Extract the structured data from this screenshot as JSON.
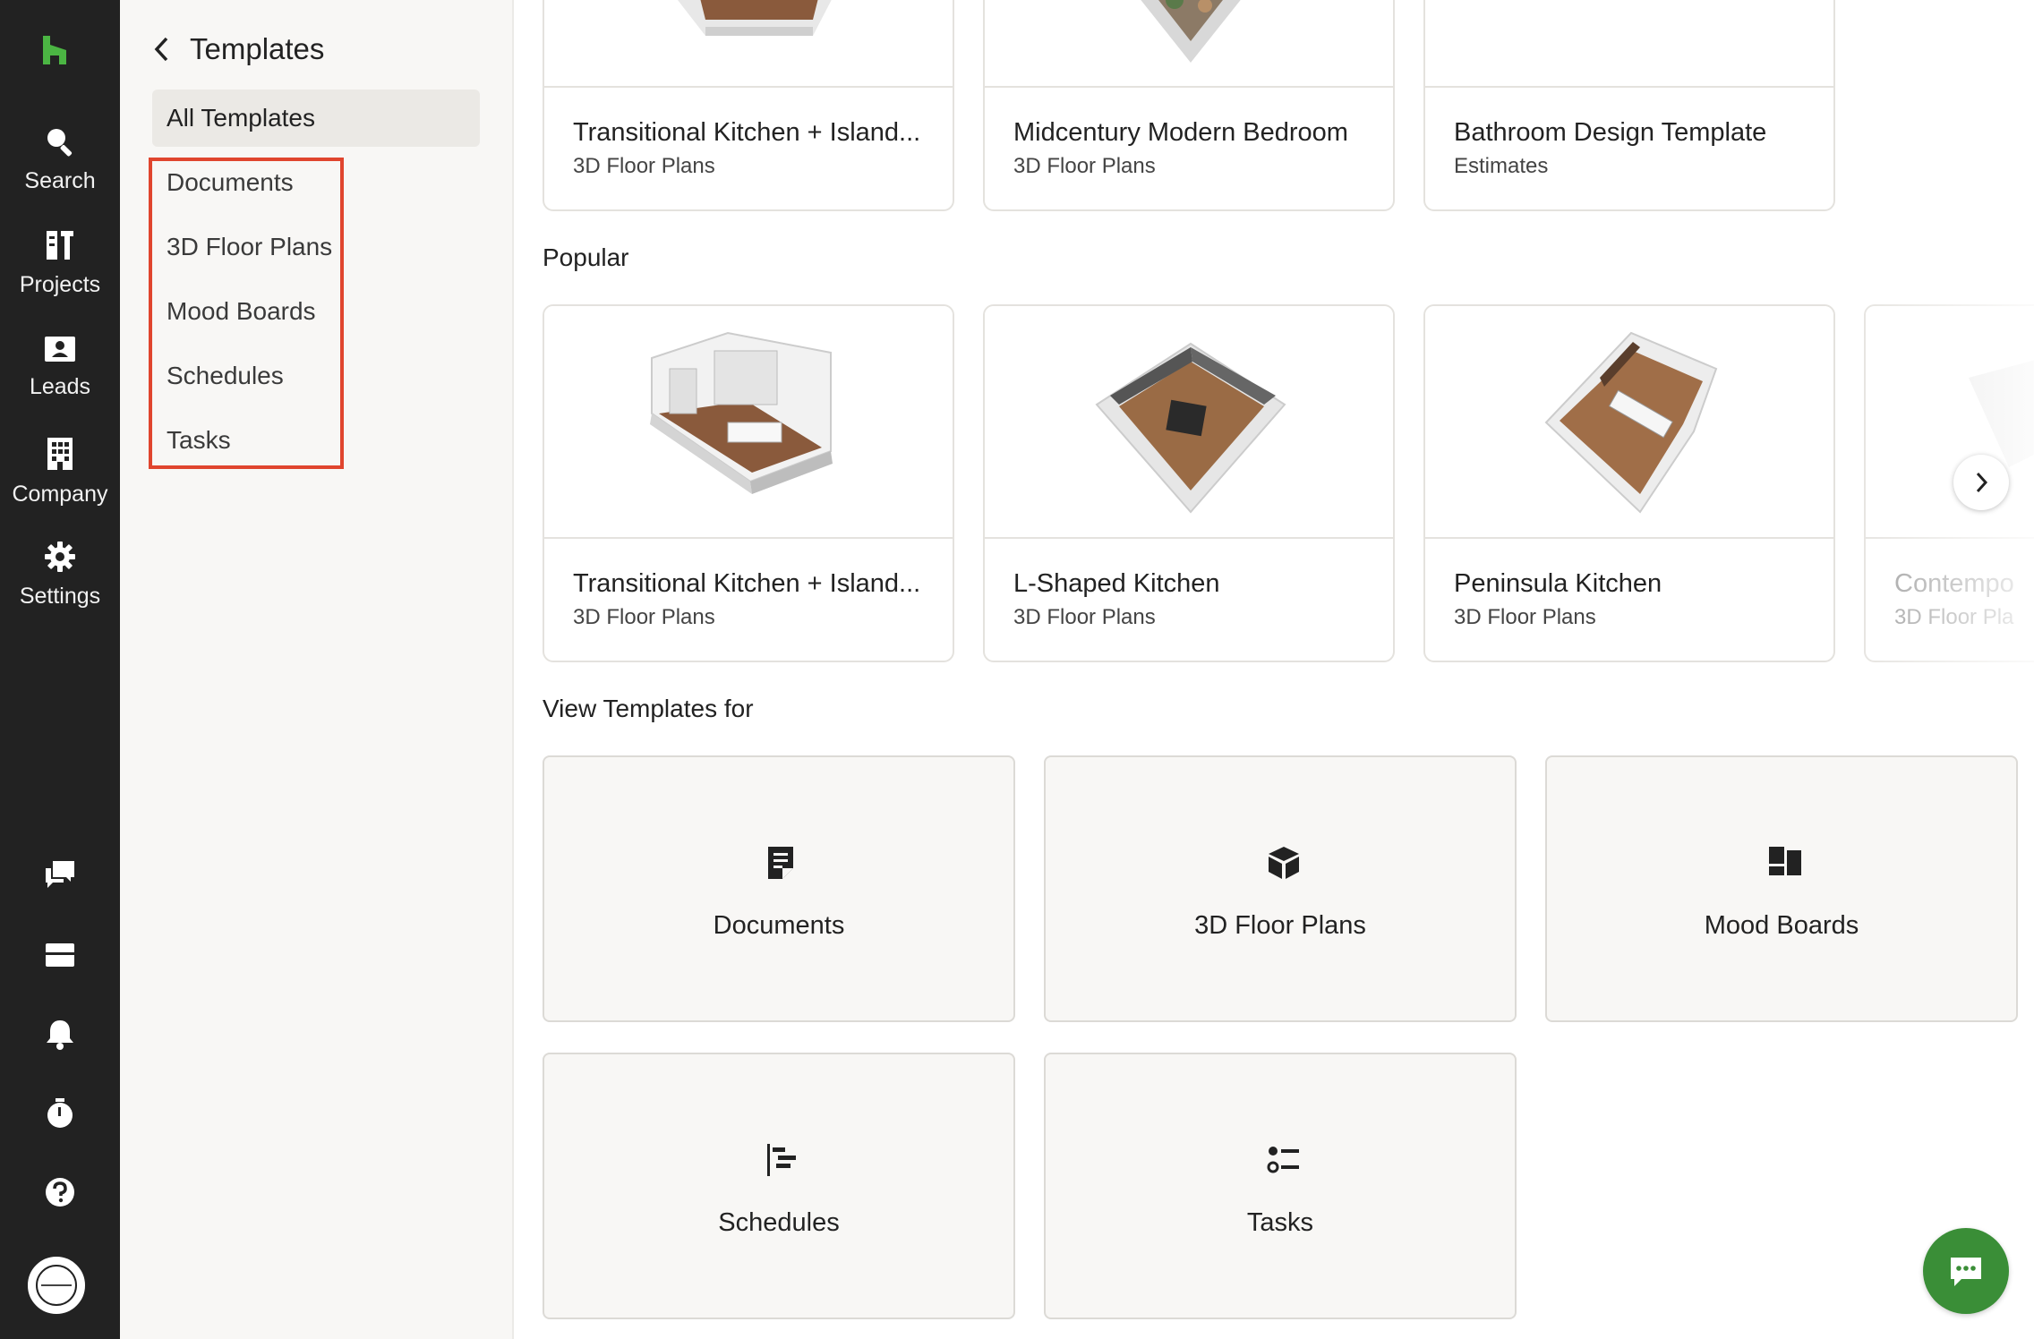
{
  "rail": {
    "items": [
      {
        "label": "Search",
        "icon": "search-icon"
      },
      {
        "label": "Projects",
        "icon": "projects-icon"
      },
      {
        "label": "Leads",
        "icon": "leads-icon"
      },
      {
        "label": "Company",
        "icon": "company-icon"
      },
      {
        "label": "Settings",
        "icon": "gear-icon"
      }
    ],
    "bottom_icons": [
      "messages-icon",
      "inbox-icon",
      "bell-icon",
      "timer-icon",
      "help-icon"
    ],
    "brand_color": "#4bb543"
  },
  "subnav": {
    "title": "Templates",
    "all_label": "All Templates",
    "items": [
      "Documents",
      "3D Floor Plans",
      "Mood Boards",
      "Schedules",
      "Tasks"
    ],
    "highlight_color": "#e0452e"
  },
  "recent": [
    {
      "name": "Transitional Kitchen + Island...",
      "type": "3D Floor Plans"
    },
    {
      "name": "Midcentury Modern Bedroom",
      "type": "3D Floor Plans"
    },
    {
      "name": "Bathroom Design Template",
      "type": "Estimates"
    }
  ],
  "popular": {
    "title": "Popular",
    "cards": [
      {
        "name": "Transitional Kitchen + Island...",
        "type": "3D Floor Plans"
      },
      {
        "name": "L-Shaped Kitchen",
        "type": "3D Floor Plans"
      },
      {
        "name": "Peninsula Kitchen",
        "type": "3D Floor Plans"
      },
      {
        "name": "Contempo",
        "type": "3D Floor Pla"
      }
    ]
  },
  "view_for": {
    "title": "View Templates for",
    "tiles": [
      {
        "label": "Documents",
        "icon": "document-icon"
      },
      {
        "label": "3D Floor Plans",
        "icon": "cube-icon"
      },
      {
        "label": "Mood Boards",
        "icon": "moodboard-icon"
      },
      {
        "label": "Schedules",
        "icon": "schedule-icon"
      },
      {
        "label": "Tasks",
        "icon": "tasks-icon"
      }
    ]
  },
  "chat_color": "#3a8e37"
}
